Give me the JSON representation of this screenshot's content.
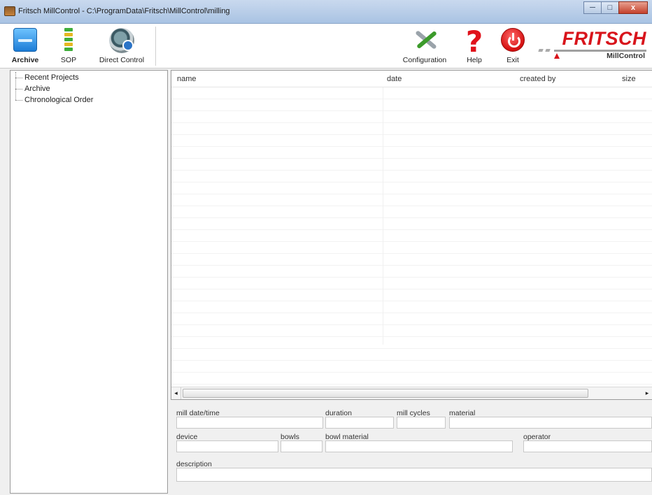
{
  "window": {
    "title": "Fritsch MillControl - C:\\ProgramData\\Fritsch\\MillControl\\milling",
    "minimize": "─",
    "maximize": "□",
    "close": "x"
  },
  "toolbar": {
    "archive_label": "Archive",
    "sop_label": "SOP",
    "direct_control_label": "Direct Control",
    "configuration_label": "Configuration",
    "help_label": "Help",
    "help_glyph": "?",
    "exit_label": "Exit"
  },
  "logo": {
    "brand": "FRITSCH",
    "product": "MillControl"
  },
  "tree": {
    "items": [
      "Recent Projects",
      "Archive",
      "Chronological Order"
    ]
  },
  "grid": {
    "columns": [
      "name",
      "date",
      "created by",
      "size"
    ],
    "rows": []
  },
  "scrollbar": {
    "left_arrow": "◂",
    "right_arrow": "▸"
  },
  "details": {
    "mill_datetime_label": "mill date/time",
    "duration_label": "duration",
    "mill_cycles_label": "mill cycles",
    "material_label": "material",
    "device_label": "device",
    "bowls_label": "bowls",
    "bowl_material_label": "bowl material",
    "operator_label": "operator",
    "description_label": "description",
    "mill_datetime": "",
    "duration": "",
    "mill_cycles": "",
    "material": "",
    "device": "",
    "bowls": "",
    "bowl_material": "",
    "operator": "",
    "description": ""
  },
  "colors": {
    "brand_red": "#d8141b",
    "titlebar": "#b9cfe9"
  },
  "icons": [
    "archive-icon",
    "sop-icon",
    "direct-control-icon",
    "configuration-icon",
    "help-icon",
    "exit-icon"
  ]
}
